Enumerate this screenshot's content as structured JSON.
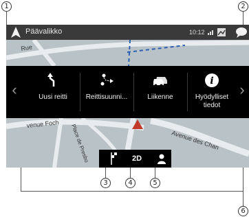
{
  "callouts": {
    "c1": "1",
    "c2": "2",
    "c3": "3",
    "c4": "4",
    "c5": "5",
    "c6": "6"
  },
  "statusbar": {
    "title": "Päävalikko",
    "time": "10:12"
  },
  "menu": {
    "items": [
      {
        "label": "Uusi reitti",
        "icon": "route-arrow-icon"
      },
      {
        "label": "Reittisuunni...",
        "icon": "route-plan-icon"
      },
      {
        "label": "Liikenne",
        "icon": "traffic-car-icon"
      },
      {
        "label": "Hyödylliset tiedot",
        "icon": "info-icon"
      }
    ]
  },
  "map": {
    "streets": [
      "Rue",
      "venue Foch",
      "Place de Presbo",
      "Avenue des Chan"
    ]
  },
  "bottom": {
    "view_mode": "2D"
  },
  "colors": {
    "statusbar": "#3a3a3a",
    "menu_panel": "#000000",
    "map": "#b9c2c6"
  }
}
